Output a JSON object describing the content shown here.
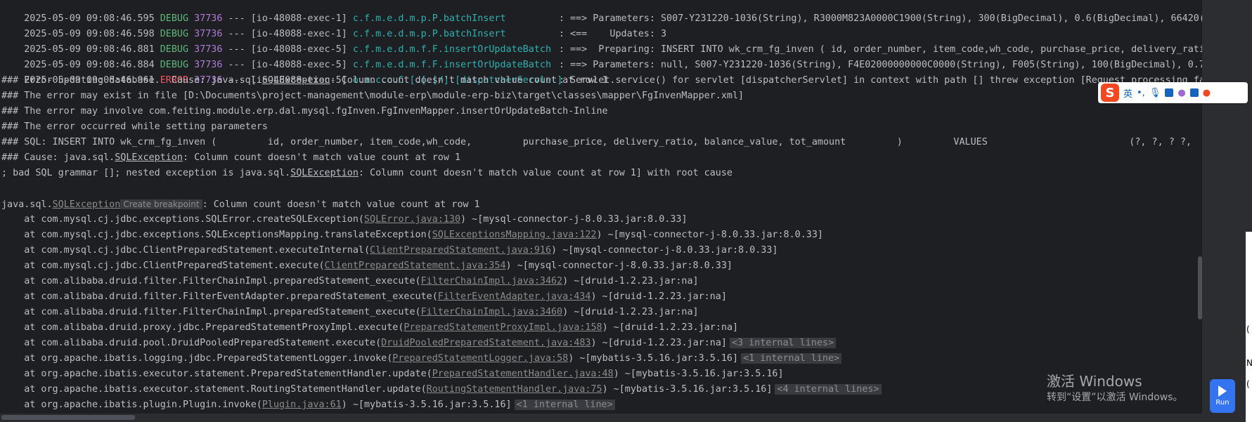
{
  "log_lines": [
    {
      "ts": "2025-05-09 09:08:46.595",
      "level": "DEBUG",
      "pid": "37736",
      "sep": "---",
      "thread": "[io-48088-exec-1]",
      "logger": "c.f.m.e.d.m.p.P.batchInsert",
      "msg": ": ==> Parameters: S007-Y231220-1036(String), R3000M823A0000C1900(String), 300(BigDecimal), 0.6(BigDecimal), 66420(B"
    },
    {
      "ts": "2025-05-09 09:08:46.598",
      "level": "DEBUG",
      "pid": "37736",
      "sep": "---",
      "thread": "[io-48088-exec-1]",
      "logger": "c.f.m.e.d.m.p.P.batchInsert",
      "msg": ": <==    Updates: 3"
    },
    {
      "ts": "2025-05-09 09:08:46.881",
      "level": "DEBUG",
      "pid": "37736",
      "sep": "---",
      "thread": "[io-48088-exec-5]",
      "logger": "c.f.m.e.d.m.f.F.insertOrUpdateBatch",
      "msg": ": ==>  Preparing: INSERT INTO wk_crm_fg_inven ( id, order_number, item_code,wh_code, purchase_price, delivery_ratio"
    },
    {
      "ts": "2025-05-09 09:08:46.884",
      "level": "DEBUG",
      "pid": "37736",
      "sep": "---",
      "thread": "[io-48088-exec-5]",
      "logger": "c.f.m.e.d.m.f.F.insertOrUpdateBatch",
      "msg": ": ==> Parameters: null, S007-Y231220-1036(String), F4E02000000000C0000(String), F005(String), 100(BigDecimal), 0.7("
    },
    {
      "ts": "2025-05-09 09:08:46.961",
      "level": "ERROR",
      "pid": "37736",
      "sep": "---",
      "thread": "[io-48088-exec-5]",
      "logger": "o.a.c.c.C.[.[.[/].[dispatcherServlet]",
      "msg": ": Servlet.service() for servlet [dispatcherServlet] in context with path [] threw exception [Request processing fai"
    }
  ],
  "error_lines": {
    "l1_pre": "### Error updating database.  Cause: java.sql.",
    "l1_exc": "SQLException",
    "l1_post": ": Column count doesn't match value count at row 1",
    "l2": "### The error may exist in file [D:\\Documents\\project-management\\module-erp\\module-erp-biz\\target\\classes\\mapper\\FgInvenMapper.xml]",
    "l3": "### The error may involve com.feiting.module.erp.dal.mysql.fgInven.FgInvenMapper.insertOrUpdateBatch-Inline",
    "l4": "### The error occurred while setting parameters",
    "l5": "### SQL: INSERT INTO wk_crm_fg_inven (         id, order_number, item_code,wh_code,         purchase_price, delivery_ratio, balance_value, tot_amount         )         VALUES                         (?, ?, ? ?,",
    "l6_pre": "### Cause: java.sql.",
    "l6_exc": "SQLException",
    "l6_post": ": Column count doesn't match value count at row 1",
    "l7_pre": "; bad SQL grammar []; nested exception is java.sql.",
    "l7_exc": "SQLException",
    "l7_post": ": Column count doesn't match value count at row 1] with root cause"
  },
  "exception_header": {
    "pre": "java.sql.",
    "exc": "SQLException",
    "hint": "Create breakpoint",
    "post": ": Column count doesn't match value count at row 1"
  },
  "stack": [
    {
      "pre": "    at com.mysql.cj.jdbc.exceptions.SQLError.createSQLException(",
      "link": "SQLError.java:130",
      "post": ") ~[mysql-connector-j-8.0.33.jar:8.0.33]",
      "fold": ""
    },
    {
      "pre": "    at com.mysql.cj.jdbc.exceptions.SQLExceptionsMapping.translateException(",
      "link": "SQLExceptionsMapping.java:122",
      "post": ") ~[mysql-connector-j-8.0.33.jar:8.0.33]",
      "fold": ""
    },
    {
      "pre": "    at com.mysql.cj.jdbc.ClientPreparedStatement.executeInternal(",
      "link": "ClientPreparedStatement.java:916",
      "post": ") ~[mysql-connector-j-8.0.33.jar:8.0.33]",
      "fold": ""
    },
    {
      "pre": "    at com.mysql.cj.jdbc.ClientPreparedStatement.execute(",
      "link": "ClientPreparedStatement.java:354",
      "post": ") ~[mysql-connector-j-8.0.33.jar:8.0.33]",
      "fold": ""
    },
    {
      "pre": "    at com.alibaba.druid.filter.FilterChainImpl.preparedStatement_execute(",
      "link": "FilterChainImpl.java:3462",
      "post": ") ~[druid-1.2.23.jar:na]",
      "fold": ""
    },
    {
      "pre": "    at com.alibaba.druid.filter.FilterEventAdapter.preparedStatement_execute(",
      "link": "FilterEventAdapter.java:434",
      "post": ") ~[druid-1.2.23.jar:na]",
      "fold": ""
    },
    {
      "pre": "    at com.alibaba.druid.filter.FilterChainImpl.preparedStatement_execute(",
      "link": "FilterChainImpl.java:3460",
      "post": ") ~[druid-1.2.23.jar:na]",
      "fold": ""
    },
    {
      "pre": "    at com.alibaba.druid.proxy.jdbc.PreparedStatementProxyImpl.execute(",
      "link": "PreparedStatementProxyImpl.java:158",
      "post": ") ~[druid-1.2.23.jar:na]",
      "fold": ""
    },
    {
      "pre": "    at com.alibaba.druid.pool.DruidPooledPreparedStatement.execute(",
      "link": "DruidPooledPreparedStatement.java:483",
      "post": ") ~[druid-1.2.23.jar:na]",
      "fold": "<3 internal lines>"
    },
    {
      "pre": "    at org.apache.ibatis.logging.jdbc.PreparedStatementLogger.invoke(",
      "link": "PreparedStatementLogger.java:58",
      "post": ") ~[mybatis-3.5.16.jar:3.5.16]",
      "fold": "<1 internal line>"
    },
    {
      "pre": "    at org.apache.ibatis.executor.statement.PreparedStatementHandler.update(",
      "link": "PreparedStatementHandler.java:48",
      "post": ") ~[mybatis-3.5.16.jar:3.5.16]",
      "fold": ""
    },
    {
      "pre": "    at org.apache.ibatis.executor.statement.RoutingStatementHandler.update(",
      "link": "RoutingStatementHandler.java:75",
      "post": ") ~[mybatis-3.5.16.jar:3.5.16]",
      "fold": "<4 internal lines>"
    },
    {
      "pre": "    at org.apache.ibatis.plugin.Plugin.invoke(",
      "link": "Plugin.java:61",
      "post": ") ~[mybatis-3.5.16.jar:3.5.16]",
      "fold": "<1 internal line>"
    }
  ],
  "ime": {
    "logo": "S",
    "lang": "英",
    "punct": "•,"
  },
  "watermark": {
    "line1": "激活 Windows",
    "line2": "转到“设置”以激活 Windows。"
  },
  "run_button": {
    "label": "Run"
  },
  "edge_glyphs": [
    "(",
    "N",
    "("
  ],
  "colors": {
    "background": "#1e1f22",
    "debug": "#5fb87a",
    "error": "#f75464",
    "pid": "#b07cd8",
    "logger": "#2fb0b0",
    "run": "#3574f0"
  }
}
